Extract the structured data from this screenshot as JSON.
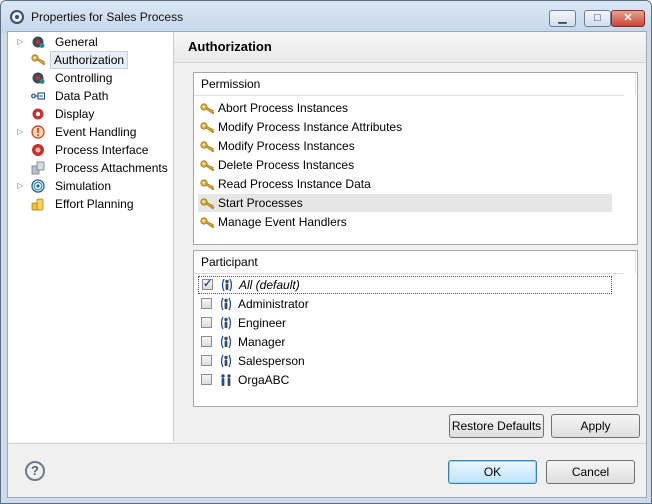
{
  "window": {
    "title": "Properties for Sales Process",
    "min_glyph": "▁",
    "max_glyph": "□",
    "close_glyph": "✕"
  },
  "tree": {
    "items": [
      {
        "label": "General",
        "expandable": true,
        "icon": "gear-icon"
      },
      {
        "label": "Authorization",
        "expandable": false,
        "icon": "key-icon",
        "selected": true
      },
      {
        "label": "Controlling",
        "expandable": false,
        "icon": "gear-icon"
      },
      {
        "label": "Data Path",
        "expandable": false,
        "icon": "data-path-icon"
      },
      {
        "label": "Display",
        "expandable": false,
        "icon": "gear-red-icon"
      },
      {
        "label": "Event Handling",
        "expandable": true,
        "icon": "alert-icon"
      },
      {
        "label": "Process Interface",
        "expandable": false,
        "icon": "process-interface-icon"
      },
      {
        "label": "Process Attachments",
        "expandable": false,
        "icon": "attachments-icon"
      },
      {
        "label": "Simulation",
        "expandable": true,
        "icon": "spiral-icon"
      },
      {
        "label": "Effort Planning",
        "expandable": false,
        "icon": "coins-icon"
      }
    ]
  },
  "page": {
    "title": "Authorization"
  },
  "permission": {
    "header": "Permission",
    "items": [
      "Abort Process Instances",
      "Modify Process Instance Attributes",
      "Modify Process Instances",
      "Delete Process Instances",
      "Read Process Instance Data",
      "Start Processes",
      "Manage Event Handlers"
    ],
    "selected_index": 5
  },
  "participant": {
    "header": "Participant",
    "items": [
      {
        "label": "All (default)",
        "checked": true,
        "italic": true,
        "icon": "role-icon"
      },
      {
        "label": "Administrator",
        "checked": false,
        "icon": "role-icon"
      },
      {
        "label": "Engineer",
        "checked": false,
        "icon": "role-icon"
      },
      {
        "label": "Manager",
        "checked": false,
        "icon": "role-icon"
      },
      {
        "label": "Salesperson",
        "checked": false,
        "icon": "role-icon"
      },
      {
        "label": "OrgaABC",
        "checked": false,
        "icon": "organization-icon"
      }
    ]
  },
  "buttons": {
    "restore_defaults": "Restore Defaults",
    "apply": "Apply",
    "ok": "OK",
    "cancel": "Cancel",
    "help": "?"
  }
}
